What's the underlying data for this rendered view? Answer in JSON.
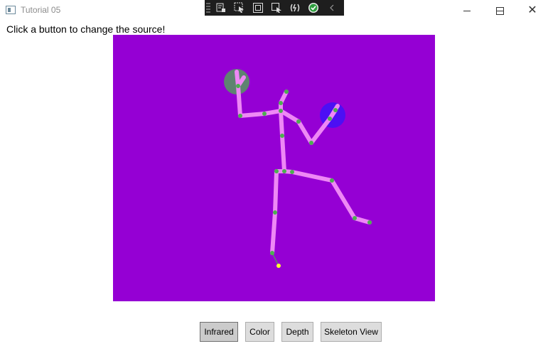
{
  "window": {
    "title": "Tutorial 05",
    "close_glyph": "✕"
  },
  "debug_toolbar": {
    "icons": [
      "live-visual-tree-icon",
      "select-element-icon",
      "display-layout-adorners-icon",
      "track-focus-icon",
      "hot-reload-icon",
      "binding-failures-check-icon",
      "collapse-icon"
    ]
  },
  "main": {
    "instruction": "Click a button to change the source!"
  },
  "viewport": {
    "background": "#9500d4",
    "bones": "#ee88f5",
    "joints": "#4caf50",
    "hand_left_state": "#4caf50",
    "hand_right_state": "#3414ff",
    "inferred_joint": "#ffff33"
  },
  "buttons": {
    "infrared": "Infrared",
    "color": "Color",
    "depth": "Depth",
    "skeleton": "Skeleton View"
  }
}
